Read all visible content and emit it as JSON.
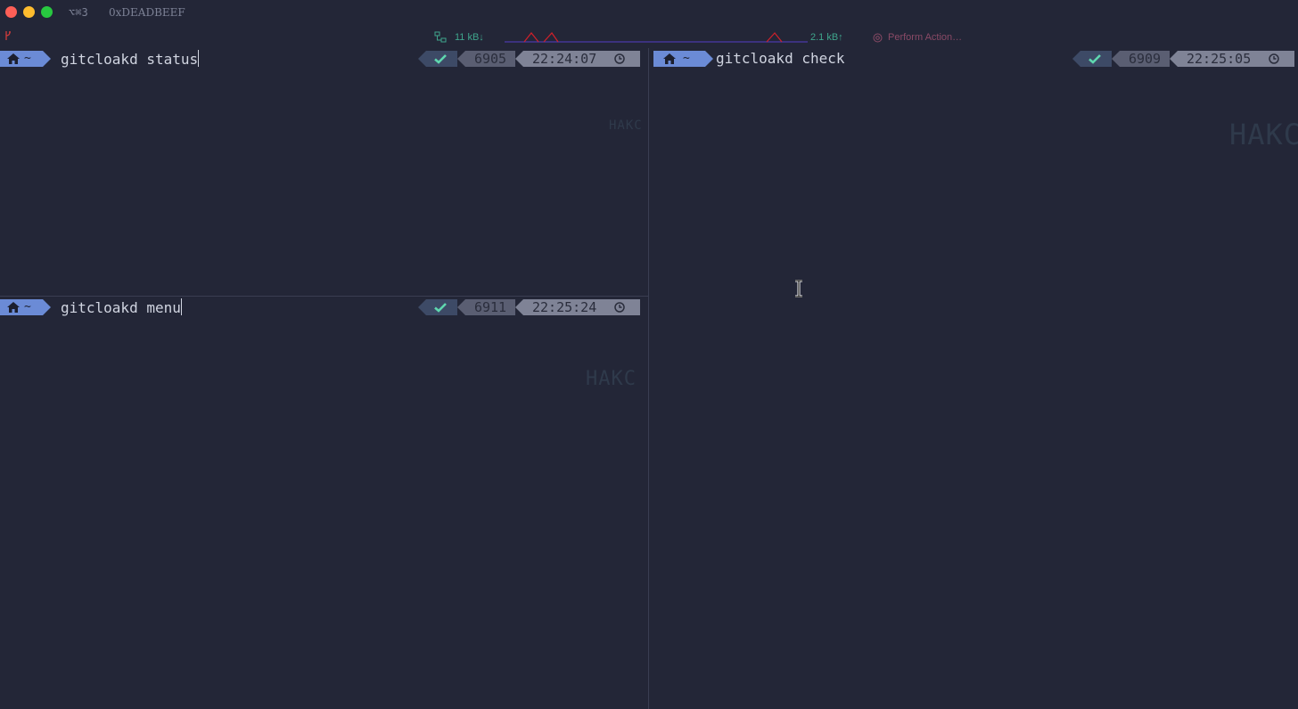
{
  "window": {
    "shortcut": "⌥⌘3",
    "title": "0xDEADBEEF"
  },
  "statusbar": {
    "net_down": "11 kB↓",
    "net_up": "2.1 kB↑",
    "action_label": "Perform Action…",
    "colors": {
      "network": "#3fa58c",
      "action": "#8a4a66",
      "graph_down": "#d0202a",
      "graph_up": "#4a3aa8"
    }
  },
  "panes": {
    "top_left": {
      "dir": "~",
      "command": "gitcloakd status",
      "history_number": "6905",
      "time": "22:24:07",
      "watermark": "HAKC"
    },
    "bottom_left": {
      "dir": "~",
      "command": "gitcloakd menu",
      "history_number": "6911",
      "time": "22:25:24",
      "watermark": "HAKC"
    },
    "right": {
      "dir": "~",
      "command": "gitcloakd check",
      "history_number": "6909",
      "time": "22:25:05",
      "watermark": "HAKC"
    }
  },
  "icons": {
    "home": "home-icon",
    "check": "check-icon",
    "clock": "clock-icon",
    "network": "network-icon",
    "action": "target-icon",
    "git": "git-branch-icon"
  },
  "theme": {
    "background": "#232637",
    "prompt_accent": "#6b8bd6",
    "check_color": "#5fd7af"
  }
}
